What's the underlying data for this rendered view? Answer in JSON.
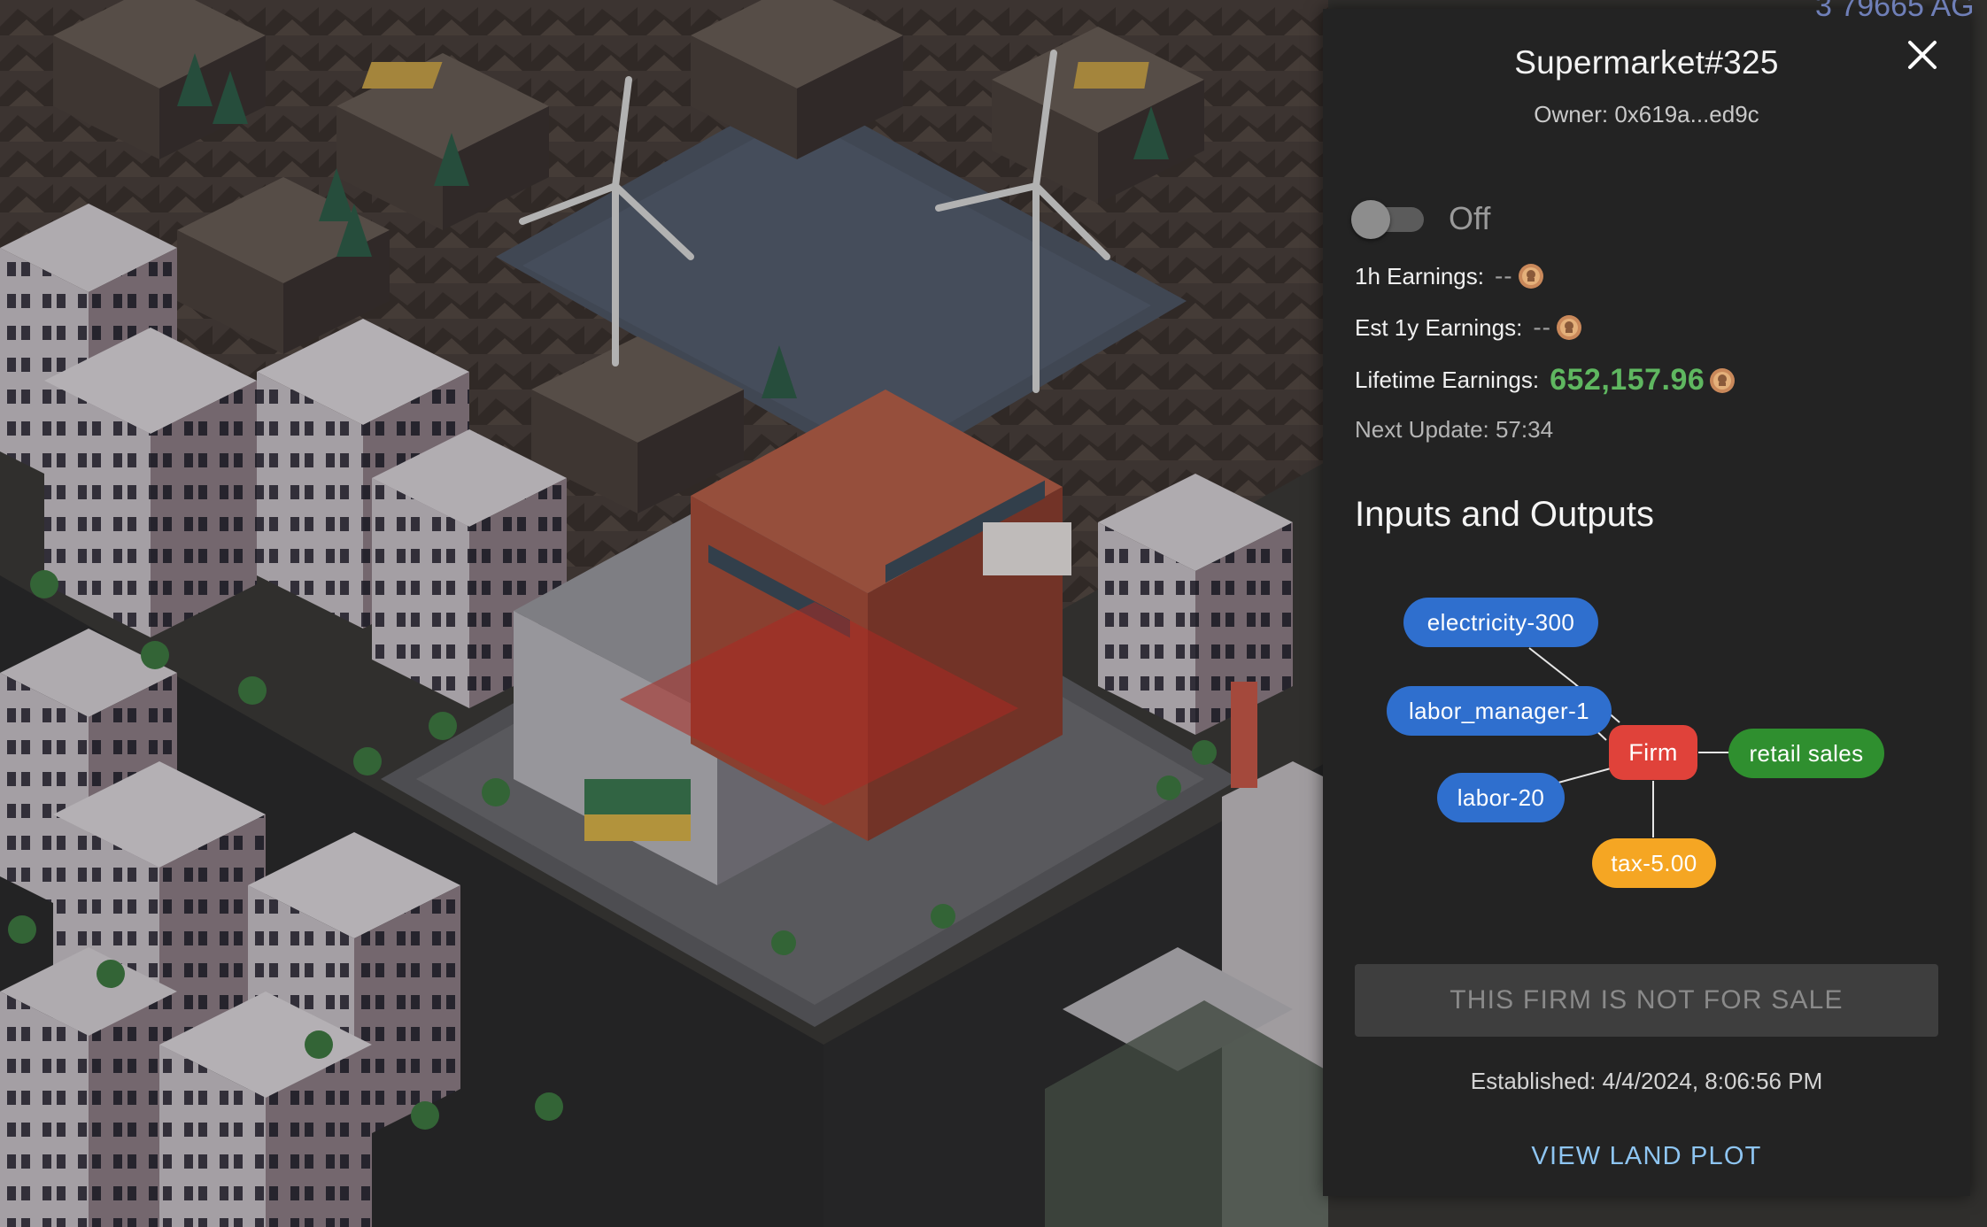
{
  "firm": {
    "name": "Supermarket#325",
    "owner": "Owner: 0x619a...ed9c"
  },
  "status": {
    "toggle_state": "off",
    "toggle_label": "Off"
  },
  "earnings": {
    "hourly_label": "1h Earnings:",
    "hourly_value": "--",
    "yearly_label": "Est 1y Earnings:",
    "yearly_value": "--",
    "lifetime_label": "Lifetime Earnings:",
    "lifetime_value": "652,157.96",
    "coin_icon": "coin-icon",
    "next_update": "Next Update: 57:34"
  },
  "io": {
    "title": "Inputs and Outputs",
    "inputs": [
      "electricity-300",
      "labor_manager-1",
      "labor-20"
    ],
    "center": "Firm",
    "outputs": [
      "retail sales"
    ],
    "tax": "tax-5.00",
    "colors": {
      "input": "#2f6fce",
      "firm": "#e0423a",
      "output": "#2f8f2f",
      "tax": "#f5a623"
    }
  },
  "actions": {
    "sale_label": "THIS FIRM IS NOT FOR SALE",
    "established": "Established: 4/4/2024, 8:06:56 PM",
    "view_plot": "VIEW LAND PLOT"
  },
  "map_overlay": {
    "corner_text": "3 79665 AG"
  }
}
